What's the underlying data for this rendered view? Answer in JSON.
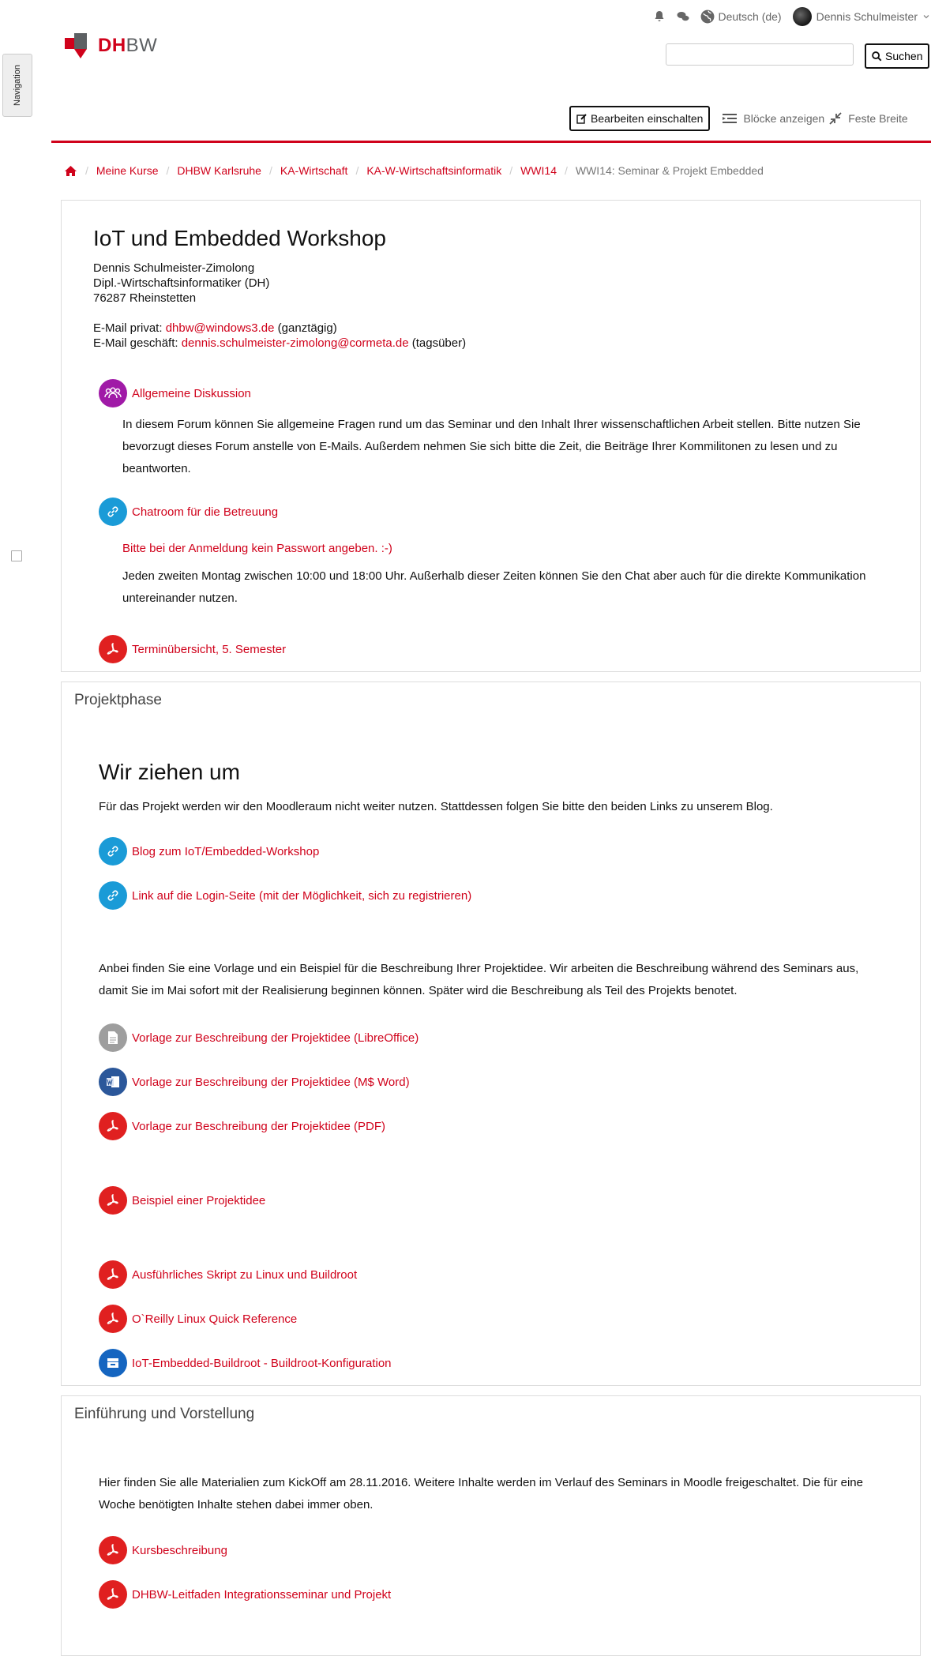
{
  "topbar": {
    "language": "Deutsch (de)",
    "user_name": "Dennis Schulmeister"
  },
  "logo": {
    "text_red": "DH",
    "text_grey": "BW"
  },
  "search": {
    "button": "Suchen",
    "value": ""
  },
  "nav_tab": "Navigation",
  "toolbar": {
    "edit": "Bearbeiten einschalten",
    "blocks": "Blöcke anzeigen",
    "width": "Feste Breite"
  },
  "breadcrumb": [
    "Meine Kurse",
    "DHBW Karlsruhe",
    "KA-Wirtschaft",
    "KA-W-Wirtschaftsinformatik",
    "WWI14",
    "WWI14: Seminar & Projekt Embedded"
  ],
  "course": {
    "title": "IoT und Embedded Workshop",
    "address": [
      "Dennis Schulmeister-Zimolong",
      "Dipl.-Wirtschaftsinformatiker (DH)",
      "76287 Rheinstetten"
    ],
    "mail_private_label": "E-Mail privat: ",
    "mail_private": "dhbw@windows3.de",
    "mail_private_note": " (ganztägig)",
    "mail_work_label": "E-Mail geschäft: ",
    "mail_work": "dennis.schulmeister-zimolong@cormeta.de",
    "mail_work_note": " (tagsüber)",
    "forum": "Allgemeine Diskussion",
    "forum_desc": "In diesem Forum können Sie allgemeine Fragen rund um das Seminar und den Inhalt Ihrer wissenschaftlichen Arbeit stellen. Bitte nutzen Sie bevorzugt dieses Forum anstelle von E-Mails. Außerdem nehmen Sie sich bitte die Zeit, die Beiträge Ihrer Kommilitonen zu lesen und zu beantworten.",
    "chat": "Chatroom für die Betreuung",
    "chat_note": "Bitte bei der Anmeldung kein Passwort angeben. :-)",
    "chat_desc": "Jeden zweiten Montag zwischen 10:00 und 18:00 Uhr. Außerhalb dieser Zeiten können Sie den Chat aber auch für die direkte Kommunikation untereinander nutzen.",
    "schedule": "Terminübersicht, 5. Semester"
  },
  "project": {
    "title": "Projektphase",
    "heading": "Wir ziehen um",
    "intro": "Für das Projekt werden wir den Moodleraum nicht weiter nutzen. Stattdessen folgen Sie bitte den beiden Links zu unserem Blog.",
    "link_blog": "Blog zum IoT/Embedded-Workshop",
    "link_login": "Link auf die Login-Seite (mit der Möglichkeit, sich zu registrieren)",
    "text2": "Anbei finden Sie eine Vorlage und ein Beispiel für die Beschreibung Ihrer Projektidee. Wir arbeiten die Beschreibung während des Seminars aus, damit Sie im Mai sofort mit der Realisierung beginnen können. Später wird die Beschreibung als Teil des Projekts benotet.",
    "tpl_lo": "Vorlage zur Beschreibung der Projektidee (LibreOffice)",
    "tpl_word": "Vorlage zur Beschreibung der Projektidee (M$ Word)",
    "tpl_pdf": "Vorlage zur Beschreibung der Projektidee (PDF)",
    "example": "Beispiel einer Projektidee",
    "script": "Ausführliches Skript zu Linux und Buildroot",
    "oreilly": "O`Reilly Linux Quick Reference",
    "buildroot": "IoT-Embedded-Buildroot - Buildroot-Konfiguration"
  },
  "intro_section": {
    "title": "Einführung und Vorstellung",
    "text": "Hier finden Sie alle Materialien zum KickOff am 28.11.2016. Weitere Inhalte werden im Verlauf des Seminars in Moodle freigeschaltet. Die für eine Woche benötigten Inhalte stehen dabei immer oben.",
    "course_desc": "Kursbeschreibung",
    "guide": "DHBW-Leitfaden Integrationsseminar und Projekt"
  },
  "colors": {
    "accent": "#d0021b",
    "forum": "#a01aa7",
    "link": "#1a9bd7",
    "pdf": "#e02020",
    "word": "#2b579a",
    "file": "#9e9e9e",
    "repo": "#1565c0"
  }
}
